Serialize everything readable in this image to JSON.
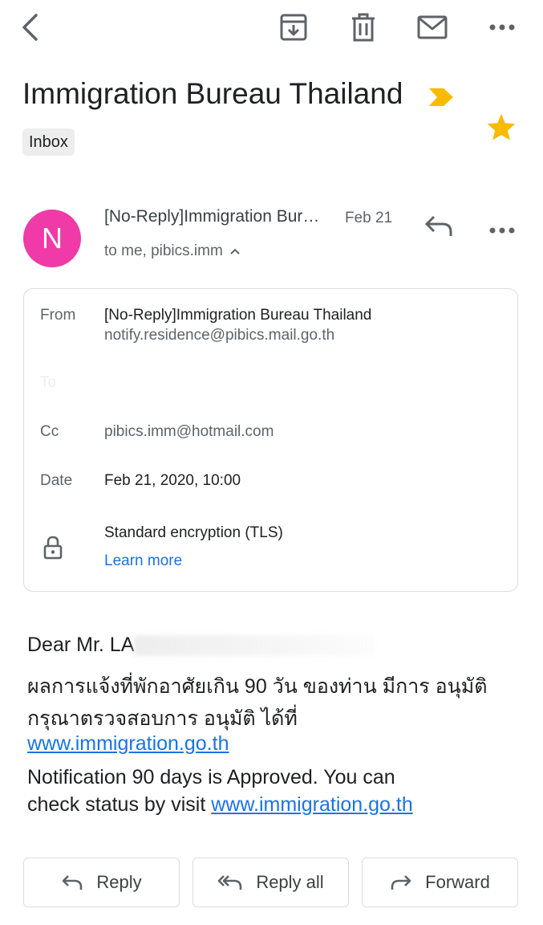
{
  "toolbar": {
    "back_icon": "back-arrow-icon",
    "archive_icon": "archive-icon",
    "delete_icon": "trash-icon",
    "mark_unread_icon": "mail-icon",
    "more_icon": "more-horizontal-icon"
  },
  "subject": "Immigration Bureau Thailand",
  "label": "Inbox",
  "starred": true,
  "colors": {
    "star": "#f9ba00",
    "important": "#f9ba00",
    "avatar": "#ef3aa8",
    "link": "#1a73e8"
  },
  "sender": {
    "initial": "N",
    "name": "[No-Reply]Immigration Bureau Thailand",
    "date": "Feb 21",
    "recipients": "to me, pibics.imm"
  },
  "details": {
    "from_label": "From",
    "from_name": "[No-Reply]Immigration Bureau Thailand",
    "from_email": "notify.residence@pibics.mail.go.th",
    "to_label": "To",
    "cc_label": "Cc",
    "cc_value": "pibics.imm@hotmail.com",
    "date_label": "Date",
    "date_value": "Feb 21, 2020, 10:00",
    "encryption": "Standard encryption (TLS)",
    "learn_more": "Learn more"
  },
  "body": {
    "greeting": "Dear Mr. LA",
    "thai_line1": "ผลการแจ้งที่พักอาศัยเกิน 90 วัน ของท่าน มีการ อนุมัติ",
    "thai_line2": "กรุณาตรวจสอบการ อนุมัติ ได้ที่",
    "link1": "www.immigration.go.th",
    "en_line1": "Notification 90 days is Approved. You can",
    "en_line2": "check status by visit ",
    "link2": "www.immigration.go.th"
  },
  "actions": {
    "reply": "Reply",
    "reply_all": "Reply all",
    "forward": "Forward"
  }
}
